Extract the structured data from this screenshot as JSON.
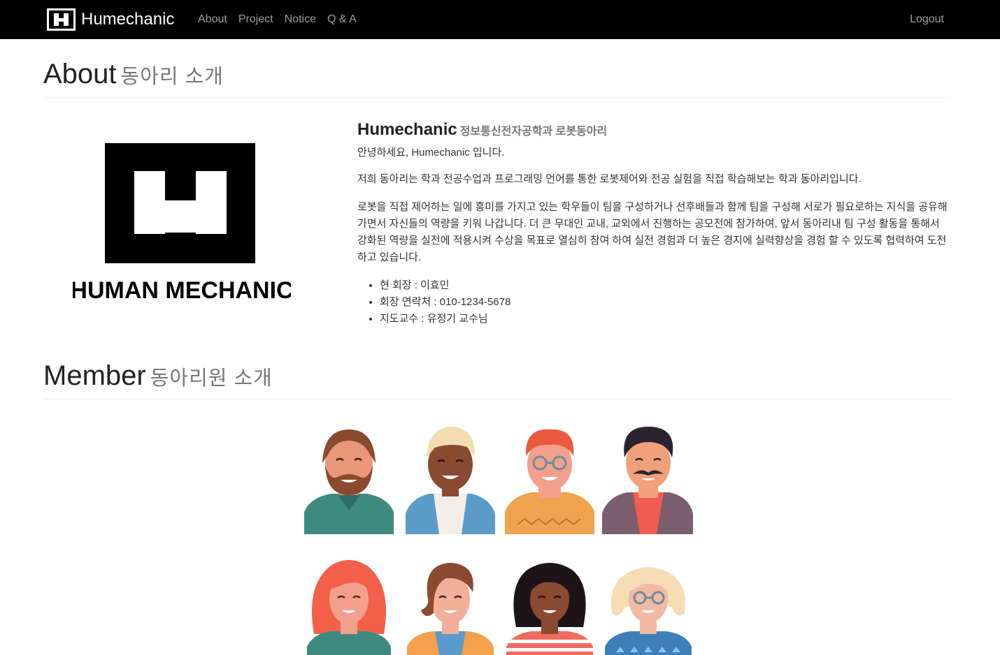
{
  "navbar": {
    "brand": "Humechanic",
    "links": [
      "About",
      "Project",
      "Notice",
      "Q & A"
    ],
    "logout": "Logout"
  },
  "about": {
    "title": "About",
    "subtitle": "동아리 소개",
    "logo_text": "HUMAN MECHANIC",
    "club_name": "Humechanic",
    "club_desc": "정보통신전자공학과 로봇동아리",
    "greeting": "안녕하세요, Humechanic 입니다.",
    "paragraph1": "저희 동아리는 학과 전공수업과 프로그래밍 언어를 통한 로봇제어와 전공 실험을 직접 학습해보는 학과 동아리입니다.",
    "paragraph2": "로봇을 직접 제어하는 일에 흥미를 가지고 있는 학우들이 팀을 구성하거나 선후배들과 함께 팀을 구성해 서로가 필요로하는 지식을 공유해 가면서 자신들의 역량을 키워 나갑니다. 더 큰 무대인 교내, 교외에서 진행하는 공모전에 참가하여, 앞서 동아리내 팀 구성 활동을 통해서 강화된 역량을 실전에 적용시켜 수상을 목표로 열심히 참여 하여 실전 경험과 더 높은 경지에 실력향상을 경험 할 수 있도록 협력하여 도전하고 있습니다.",
    "info": [
      "현 회장 : 이효민",
      "회장 연락처 : 010-1234-5678",
      "지도교수 : 유정기 교수님"
    ]
  },
  "member": {
    "title": "Member",
    "subtitle": "동아리원 소개"
  },
  "colors": {
    "navbar_bg": "#000000",
    "nav_link": "#9d9d9d",
    "heading_sub": "#777777"
  }
}
